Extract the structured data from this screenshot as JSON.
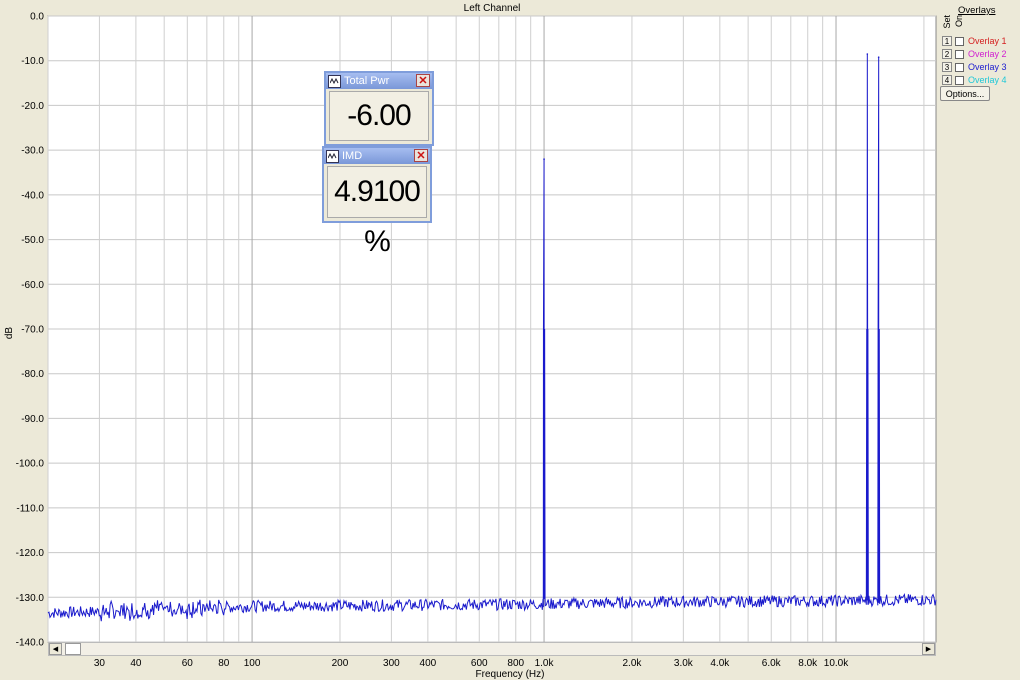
{
  "chart_data": {
    "type": "line",
    "title": "Left Channel",
    "xlabel": "Frequency (Hz)",
    "ylabel": "dB",
    "x_scale": "log",
    "xlim": [
      20,
      22000
    ],
    "ylim": [
      -140,
      0
    ],
    "grid": true,
    "y_ticks": [
      "0.0",
      "-10.0",
      "-20.0",
      "-30.0",
      "-40.0",
      "-50.0",
      "-60.0",
      "-70.0",
      "-80.0",
      "-90.0",
      "-100.0",
      "-110.0",
      "-120.0",
      "-130.0",
      "-140.0"
    ],
    "x_ticks": [
      {
        "v": 30,
        "label": "30"
      },
      {
        "v": 40,
        "label": "40"
      },
      {
        "v": 60,
        "label": "60"
      },
      {
        "v": 80,
        "label": "80"
      },
      {
        "v": 100,
        "label": "100"
      },
      {
        "v": 200,
        "label": "200"
      },
      {
        "v": 300,
        "label": "300"
      },
      {
        "v": 400,
        "label": "400"
      },
      {
        "v": 600,
        "label": "600"
      },
      {
        "v": 800,
        "label": "800"
      },
      {
        "v": 1000,
        "label": "1.0k"
      },
      {
        "v": 2000,
        "label": "2.0k"
      },
      {
        "v": 3000,
        "label": "3.0k"
      },
      {
        "v": 4000,
        "label": "4.0k"
      },
      {
        "v": 6000,
        "label": "6.0k"
      },
      {
        "v": 8000,
        "label": "8.0k"
      },
      {
        "v": 10000,
        "label": "10.0k"
      }
    ],
    "series": [
      {
        "color": "#1a1acc",
        "noise_floor": [
          [
            20,
            -133.5
          ],
          [
            40,
            -133
          ],
          [
            100,
            -132
          ],
          [
            300,
            -131.8
          ],
          [
            1000,
            -131.5
          ],
          [
            3000,
            -131
          ],
          [
            10000,
            -130.8
          ],
          [
            22000,
            -130.5
          ]
        ],
        "peaks": [
          {
            "x": 1000,
            "y": -32
          },
          {
            "x": 12800,
            "y": -8.5
          },
          {
            "x": 14000,
            "y": -9.2
          }
        ]
      }
    ]
  },
  "overlays": {
    "title": "Overlays",
    "set_label": "Set",
    "on_label": "On",
    "items": [
      {
        "num": "1",
        "name": "Overlay 1",
        "color": "#d42020"
      },
      {
        "num": "2",
        "name": "Overlay 2",
        "color": "#d020d0"
      },
      {
        "num": "3",
        "name": "Overlay 3",
        "color": "#2020d0"
      },
      {
        "num": "4",
        "name": "Overlay 4",
        "color": "#20c8d8"
      }
    ],
    "options_label": "Options..."
  },
  "meters": {
    "total_pwr": {
      "title": "Total Pwr",
      "value": "-6.00 dB"
    },
    "imd": {
      "title": "IMD",
      "value": "4.9100 %"
    }
  }
}
